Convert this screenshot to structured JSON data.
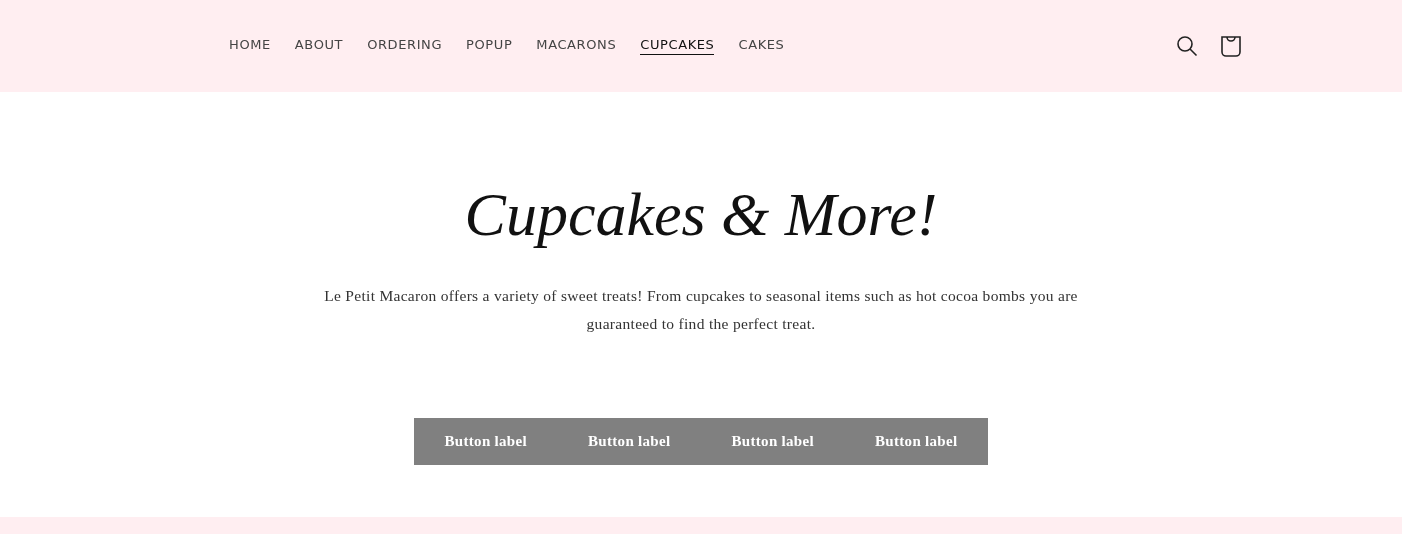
{
  "nav": [
    {
      "label": "HOME",
      "selected": false
    },
    {
      "label": "ABOUT",
      "selected": false
    },
    {
      "label": "ORDERING",
      "selected": false
    },
    {
      "label": "POPUP",
      "selected": false
    },
    {
      "label": "MACARONS",
      "selected": false
    },
    {
      "label": "CUPCAKES",
      "selected": true
    },
    {
      "label": "CAKES",
      "selected": false
    }
  ],
  "title": "Cupcakes & More!",
  "intro": "Le Petit Macaron offers a variety of sweet treats! From cupcakes to seasonal items such as hot cocoa bombs you are guaranteed to find the perfect treat.",
  "buttons": [
    "Button label",
    "Button label",
    "Button label",
    "Button label"
  ]
}
